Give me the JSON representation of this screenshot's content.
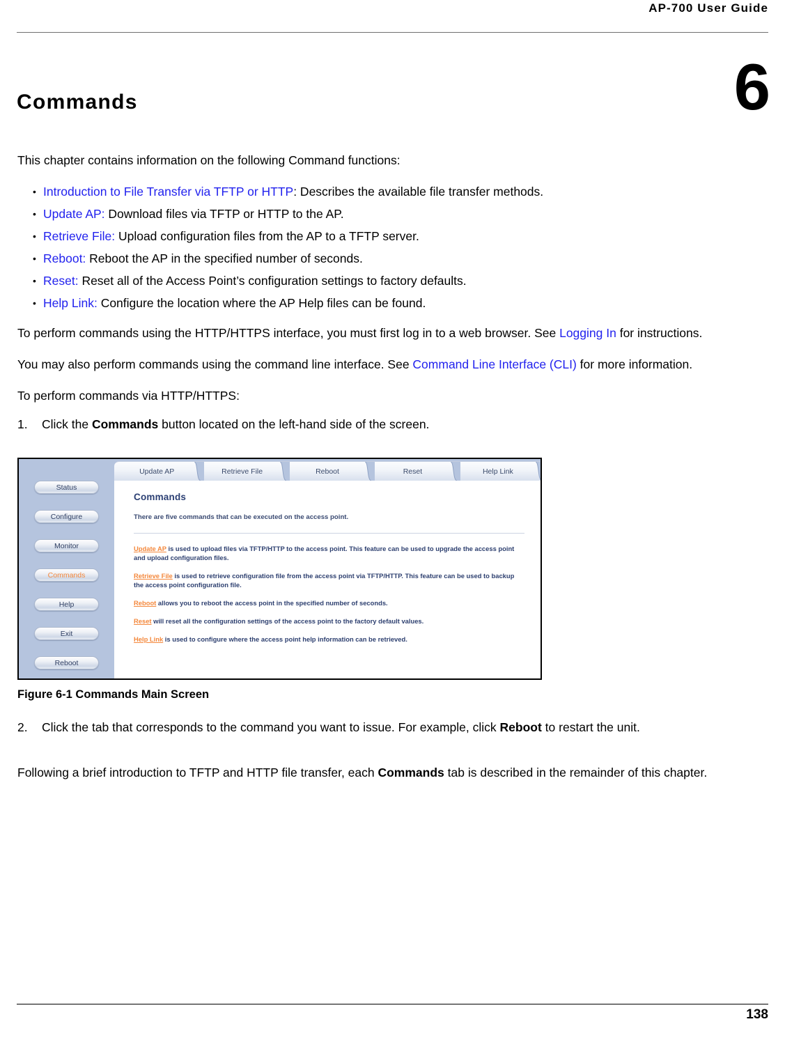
{
  "header": {
    "guide_title": "AP-700 User Guide"
  },
  "chapter": {
    "name": "Commands",
    "number": "6"
  },
  "intro": {
    "lead": "This chapter contains information on the following Command functions:",
    "bullets": [
      {
        "link": "Introduction to File Transfer via TFTP or HTTP",
        "rest": ": Describes the available file transfer methods."
      },
      {
        "link": "Update AP:",
        "rest": " Download files via TFTP or HTTP to the AP."
      },
      {
        "link": "Retrieve File:",
        "rest": " Upload configuration files from the AP to a TFTP server."
      },
      {
        "link": "Reboot:",
        "rest": " Reboot the AP in the specified number of seconds."
      },
      {
        "link": "Reset:",
        "rest": " Reset all of the Access Point’s configuration settings to factory defaults."
      },
      {
        "link": "Help Link:",
        "rest": " Configure the location where the AP Help files can be found."
      }
    ],
    "para_http_pre": "To perform commands using the HTTP/HTTPS interface, you must first log in to a web browser. See ",
    "para_http_link": "Logging In",
    "para_http_post": " for instructions.",
    "para_cli_pre": "You may also perform commands using the command line interface. See ",
    "para_cli_link": "Command Line Interface (CLI)",
    "para_cli_post": " for more information.",
    "para_perform": "To perform commands via HTTP/HTTPS:"
  },
  "steps": {
    "step1_num": "1.",
    "step1_pre": "Click the ",
    "step1_bold": "Commands",
    "step1_post": " button located on the left-hand side of the screen.",
    "step2_num": "2.",
    "step2_pre": "Click the tab that corresponds to the command you want to issue. For example, click ",
    "step2_bold": "Reboot",
    "step2_post": " to restart the unit."
  },
  "closing": {
    "pre": "Following a brief introduction to TFTP and HTTP file transfer, each ",
    "bold": "Commands",
    "post": " tab is described in the remainder of this chapter."
  },
  "figure": {
    "caption": "Figure 6-1 Commands Main Screen",
    "sidebar_buttons": [
      {
        "label": "Status",
        "active": false
      },
      {
        "label": "Configure",
        "active": false
      },
      {
        "label": "Monitor",
        "active": false
      },
      {
        "label": "Commands",
        "active": true
      },
      {
        "label": "Help",
        "active": false
      },
      {
        "label": "Exit",
        "active": false
      },
      {
        "label": "Reboot",
        "active": false
      }
    ],
    "tabs": [
      {
        "label": "Update AP"
      },
      {
        "label": "Retrieve File"
      },
      {
        "label": "Reboot"
      },
      {
        "label": "Reset"
      },
      {
        "label": "Help Link"
      }
    ],
    "heading": "Commands",
    "subtitle": "There are five commands that can be executed on the access point.",
    "descriptions": [
      {
        "cmd": "Update AP",
        "text": " is used to upload files via TFTP/HTTP to the access point. This feature can be used to upgrade the access point and upload configuration files."
      },
      {
        "cmd": "Retrieve File",
        "text": " is used to retrieve configuration file from the access point via TFTP/HTTP. This feature can be used to backup the access point configuration file."
      },
      {
        "cmd": "Reboot",
        "text": " allows you to reboot the access point in the specified number of seconds."
      },
      {
        "cmd": "Reset",
        "text": " will reset all the configuration settings of the access point to the factory default values."
      },
      {
        "cmd": "Help Link",
        "text": " is used to configure where the access point help information can be retrieved."
      }
    ],
    "colors": {
      "sidebar_bg": "#b5c4de",
      "accent_orange": "#f4883c",
      "navy_text": "#2b3f73"
    }
  },
  "footer": {
    "page_number": "138"
  }
}
